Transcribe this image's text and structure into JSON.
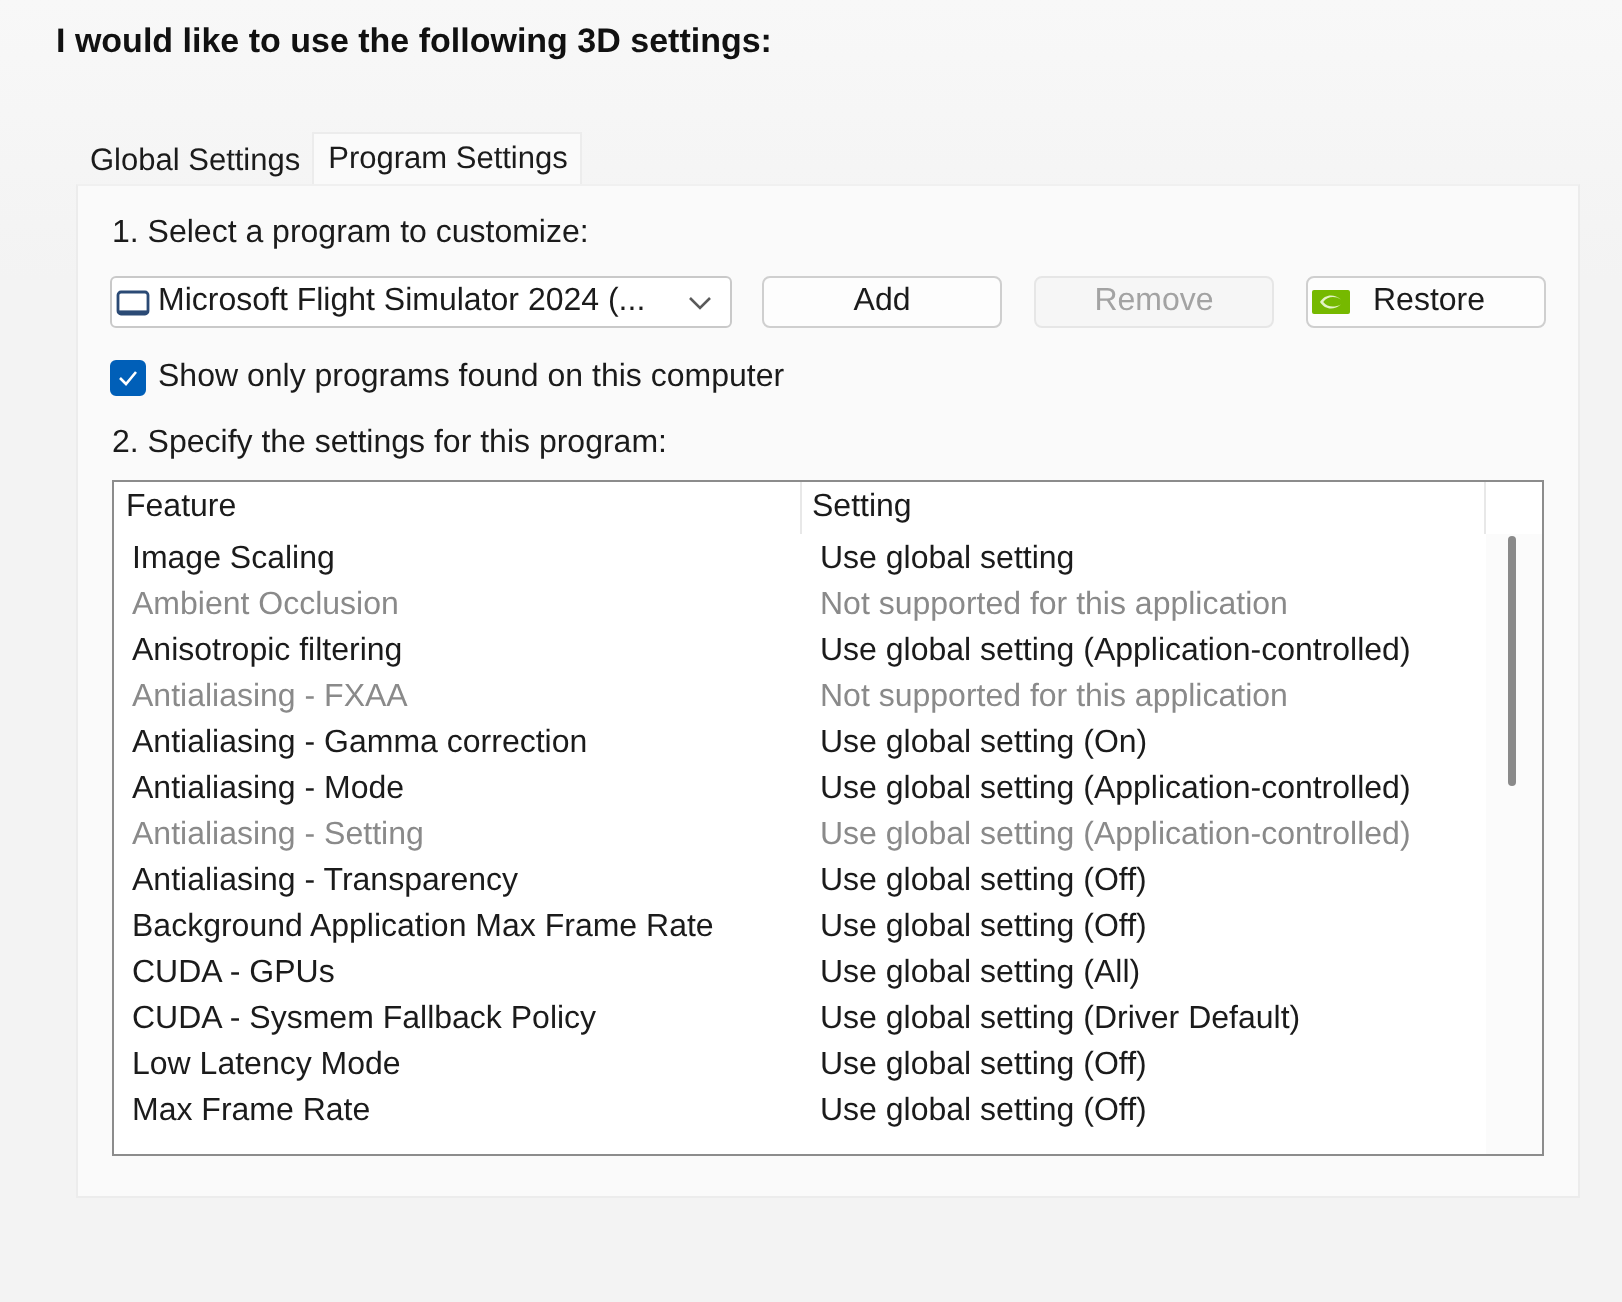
{
  "heading": "I would like to use the following 3D settings:",
  "tabs": [
    {
      "label": "Global Settings",
      "selected": false
    },
    {
      "label": "Program Settings",
      "selected": true
    }
  ],
  "program_section": {
    "label": "1. Select a program to customize:",
    "program_dropdown": {
      "value": "Microsoft Flight Simulator 2024 (..."
    },
    "buttons": [
      {
        "label": "Add",
        "kind": "plain",
        "disabled": false
      },
      {
        "label": "Remove",
        "kind": "plain",
        "disabled": true
      },
      {
        "label": "Restore",
        "kind": "logo",
        "disabled": false
      }
    ],
    "show_only_found": {
      "label": "Show only programs found on this computer",
      "checked": true
    }
  },
  "settings_section": {
    "label": "2. Specify the settings for this program:",
    "table": {
      "columns": [
        "Feature",
        "Setting"
      ],
      "rows": [
        {
          "feature": "Image Scaling",
          "setting": "Use global setting",
          "disabled": false
        },
        {
          "feature": "Ambient Occlusion",
          "setting": "Not supported for this application",
          "disabled": true
        },
        {
          "feature": "Anisotropic filtering",
          "setting": "Use global setting (Application-controlled)",
          "disabled": false
        },
        {
          "feature": "Antialiasing - FXAA",
          "setting": "Not supported for this application",
          "disabled": true
        },
        {
          "feature": "Antialiasing - Gamma correction",
          "setting": "Use global setting (On)",
          "disabled": false
        },
        {
          "feature": "Antialiasing - Mode",
          "setting": "Use global setting (Application-controlled)",
          "disabled": false
        },
        {
          "feature": "Antialiasing - Setting",
          "setting": "Use global setting (Application-controlled)",
          "disabled": true
        },
        {
          "feature": "Antialiasing - Transparency",
          "setting": "Use global setting (Off)",
          "disabled": false
        },
        {
          "feature": "Background Application Max Frame Rate",
          "setting": "Use global setting (Off)",
          "disabled": false
        },
        {
          "feature": "CUDA - GPUs",
          "setting": "Use global setting (All)",
          "disabled": false
        },
        {
          "feature": "CUDA - Sysmem Fallback Policy",
          "setting": "Use global setting (Driver Default)",
          "disabled": false
        },
        {
          "feature": "Low Latency Mode",
          "setting": "Use global setting (Off)",
          "disabled": false
        },
        {
          "feature": "Max Frame Rate",
          "setting": "Use global setting (Off)",
          "disabled": false
        }
      ]
    }
  }
}
